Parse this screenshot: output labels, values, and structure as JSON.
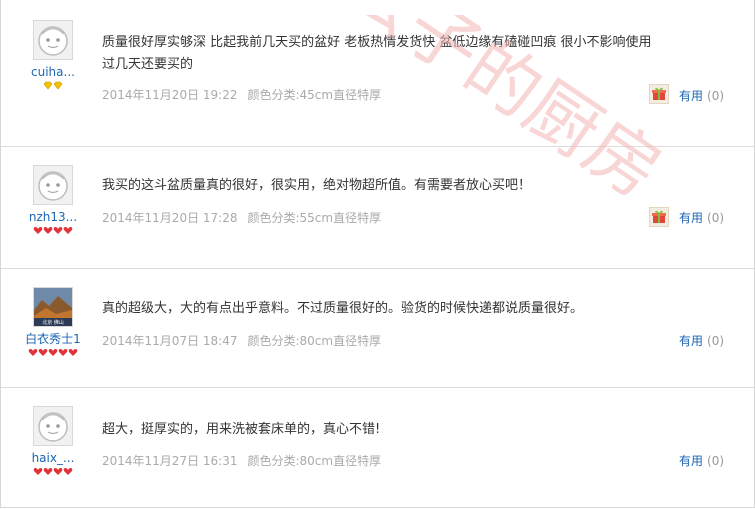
{
  "reviews": [
    {
      "username": "cuiha...",
      "avatar": "default-avatar",
      "level_icon": "gold-diamond",
      "level_count": 2,
      "text": "质量很好厚实够深 比起我前几天买的盆好 老板热情发货快 盆低边缘有磕碰凹痕 很小不影响使用 过几天还要买的",
      "date": "2014年11月20日 19:22",
      "spec": "颜色分类:45cm直径特厚",
      "gift": true,
      "useful_label": "有用",
      "useful_count": "(0)"
    },
    {
      "username": "nzh13...",
      "avatar": "default-avatar",
      "level_icon": "red-heart",
      "level_count": 4,
      "text": "我买的这斗盆质量真的很好，很实用，绝对物超所值。有需要者放心买吧！",
      "date": "2014年11月20日 17:28",
      "spec": "颜色分类:55cm直径特厚",
      "gift": true,
      "useful_label": "有用",
      "useful_count": "(0)"
    },
    {
      "username": "白衣秀士1",
      "avatar": "photo-avatar",
      "level_icon": "red-heart",
      "level_count": 5,
      "text": "真的超级大，大的有点出乎意料。不过质量很好的。验货的时候快递都说质量很好。",
      "date": "2014年11月07日 18:47",
      "spec": "颜色分类:80cm直径特厚",
      "gift": false,
      "useful_label": "有用",
      "useful_count": "(0)"
    },
    {
      "username": "haix_...",
      "avatar": "default-avatar",
      "level_icon": "red-heart",
      "level_count": 4,
      "text": "超大，挺厚实的，用来洗被套床单的，真心不错!",
      "date": "2014年11月27日 16:31",
      "spec": "颜色分类:80cm直径特厚",
      "gift": false,
      "useful_label": "有用",
      "useful_count": "(0)"
    }
  ],
  "watermark": "张公子的厨房",
  "colors": {
    "link": "#1a66b3",
    "meta": "#aaaaaa",
    "watermark": "#f2b5b5",
    "heart": "#e0333a",
    "gold": "#f2c200"
  }
}
